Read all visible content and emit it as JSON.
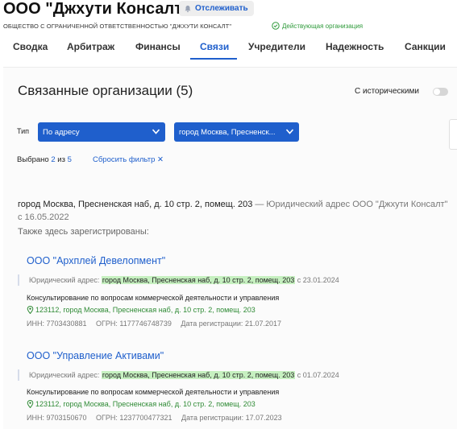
{
  "header": {
    "company_title": "ООО \"Джхути Консалт\"",
    "follow_label": "Отслеживать",
    "legal_name": "ОБЩЕСТВО С ОГРАНИЧЕННОЙ ОТВЕТСТВЕННОСТЬЮ \"ДЖХУТИ КОНСАЛТ\"",
    "status": "Действующая организация"
  },
  "tabs": [
    {
      "label": "Сводка"
    },
    {
      "label": "Арбитраж"
    },
    {
      "label": "Финансы"
    },
    {
      "label": "Связи",
      "active": true
    },
    {
      "label": "Учредители"
    },
    {
      "label": "Надежность"
    },
    {
      "label": "Санкции"
    }
  ],
  "section": {
    "title": "Связанные организации (5)",
    "historical_label": "С историческими",
    "filter_label": "Тип",
    "filter_type_value": "По адресу",
    "filter_address_value": "город Москва, Пресненск...",
    "selected_prefix": "Выбрано",
    "selected_count": "2",
    "selected_mid": "из",
    "selected_total": "5",
    "reset_label": "Сбросить фильтр ✕"
  },
  "address_group": {
    "address": "город Москва, Пресненская наб, д. 10 стр. 2, помещ. 203",
    "note": "— Юридический адрес ООО \"Джхути Консалт\" с 16.05.2022",
    "also_here": "Также здесь зарегистрированы:"
  },
  "organizations": [
    {
      "name": "ООО \"Архплей Девелопмент\"",
      "jur_prefix": "Юридический адрес:",
      "jur_address": "город Москва, Пресненская наб, д. 10 стр. 2, помещ. 203",
      "jur_since": "с 23.01.2024",
      "activity": "Консультирование по вопросам коммерческой деятельности и управления",
      "address": "123112, город Москва, Пресненская наб, д. 10 стр. 2, помещ. 203",
      "inn": "ИНН: 7703430881",
      "ogrn": "ОГРН: 1177746748739",
      "reg_date": "Дата регистрации: 21.07.2017"
    },
    {
      "name": "ООО \"Управление Активами\"",
      "jur_prefix": "Юридический адрес:",
      "jur_address": "город Москва, Пресненская наб, д. 10 стр. 2, помещ. 203",
      "jur_since": "с 01.07.2024",
      "activity": "Консультирование по вопросам коммерческой деятельности и управления",
      "address": "123112, город Москва, Пресненская наб, д. 10 стр. 2, помещ. 203",
      "inn": "ИНН: 9703150670",
      "ogrn": "ОГРН: 1237700477321",
      "reg_date": "Дата регистрации: 17.07.2023"
    }
  ],
  "colors": {
    "accent": "#1f5fcc",
    "status_green": "#2e9a3a",
    "highlight": "#c6f0c0"
  },
  "icons": {
    "follow": "bell-icon",
    "status": "check-circle-icon",
    "dropdown": "chevron-down-icon",
    "location": "location-pin-icon"
  }
}
